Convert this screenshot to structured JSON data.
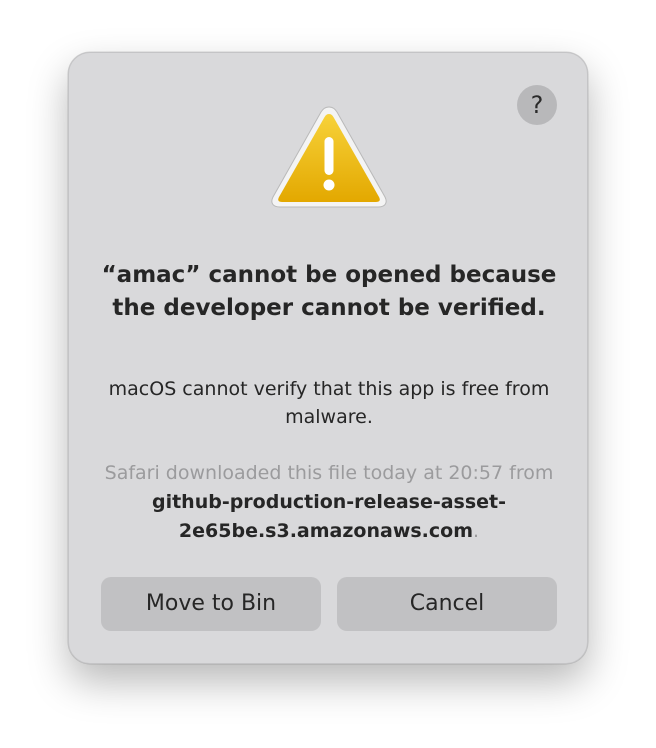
{
  "dialog": {
    "help_label": "?",
    "title": "“amac” cannot be opened because the developer cannot be verified.",
    "message": "macOS cannot verify that this app is free from malware.",
    "source_prefix": "Safari downloaded this file today at 20:57 from ",
    "source_host": "github-production-release-asset-2e65be.s3.amazonaws.com",
    "source_suffix": ".",
    "icon": "warning-icon",
    "buttons": {
      "move_to_bin": "Move to Bin",
      "cancel": "Cancel"
    }
  },
  "colors": {
    "dialog_bg": "#d9d9db",
    "button_bg": "#c1c1c3",
    "warning_yellow": "#f2c200"
  }
}
